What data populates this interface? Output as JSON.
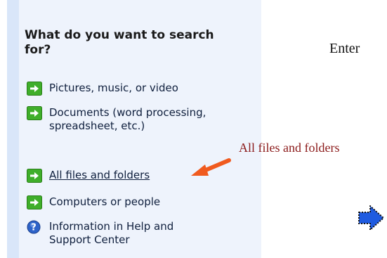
{
  "search_panel": {
    "heading": "What do you want to search for?",
    "items": [
      {
        "label": "Pictures, music, or video",
        "icon": "green-arrow-icon"
      },
      {
        "label": "Documents (word processing, spreadsheet, etc.)",
        "icon": "green-arrow-icon"
      },
      {
        "label": "All files and folders",
        "icon": "green-arrow-icon"
      },
      {
        "label": "Computers or people",
        "icon": "green-arrow-icon"
      },
      {
        "label": "Information in Help and Support Center",
        "icon": "help-icon"
      }
    ]
  },
  "annotations": {
    "enter_text": "Enter",
    "callout_text": "All files and folders",
    "callout_color": "#8b1a1a",
    "arrow_color": "#f05a1e",
    "blue_arrow_color": "#1f5be0"
  }
}
